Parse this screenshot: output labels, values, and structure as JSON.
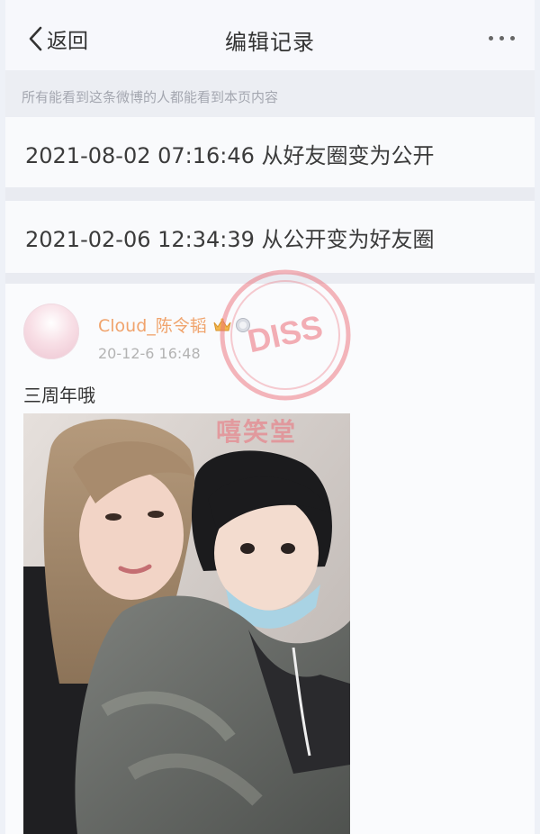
{
  "navbar": {
    "back_label": "返回",
    "title": "编辑记录",
    "more_icon": "more-dots-icon",
    "back_icon": "chevron-left-icon"
  },
  "notice": {
    "text": "所有能看到这条微博的人都能看到本页内容"
  },
  "records": [
    {
      "text": "2021-08-02 07:16:46 从好友圈变为公开"
    },
    {
      "text": "2021-02-06 12:34:39 从公开变为好友圈"
    }
  ],
  "post": {
    "author": "Cloud_陈令韬",
    "time": "20-12-6 16:48",
    "text": "三周年哦",
    "author_color": "#f0a36c"
  },
  "watermark": {
    "stamp_text": "DISS",
    "name": "嘻笑堂"
  },
  "colors": {
    "background": "#eef1f7",
    "text": "#333333",
    "muted": "#a4a7b0",
    "watermark": "#eb6e78"
  }
}
